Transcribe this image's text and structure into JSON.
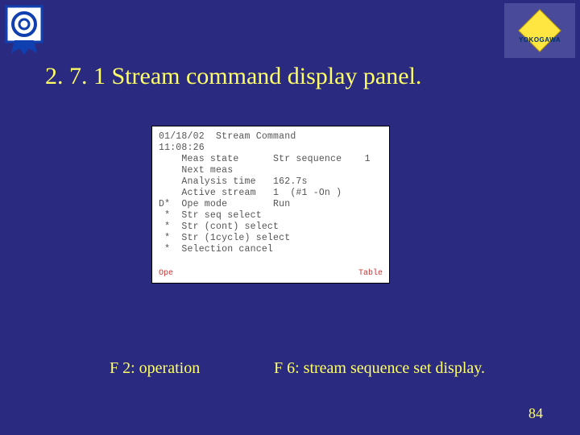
{
  "title": "2. 7. 1 Stream command display panel.",
  "panel": {
    "date": "01/18/02",
    "time": "11:08:26",
    "header": "Stream Command",
    "rows": [
      {
        "label": "Meas state",
        "mid": "Str sequence",
        "val": "1"
      },
      {
        "label": "Next meas",
        "mid": "",
        "val": ""
      },
      {
        "label": "Analysis time",
        "mid": "162.7s",
        "val": ""
      },
      {
        "label": "Active stream",
        "mid": "1  (#1 -On )",
        "val": ""
      },
      {
        "label": "Ope mode",
        "mid": "Run",
        "val": "",
        "mark": "D*"
      },
      {
        "label": "Str seq select",
        "mid": "",
        "val": "",
        "mark": " *"
      },
      {
        "label": "Str (cont) select",
        "mid": "",
        "val": "",
        "mark": " *"
      },
      {
        "label": "Str (1cycle) select",
        "mid": "",
        "val": "",
        "mark": " *"
      },
      {
        "label": "Selection cancel",
        "mid": "",
        "val": "",
        "mark": " *"
      }
    ],
    "footer_left": "Ope",
    "footer_right": "Table"
  },
  "caption_left": "F 2: operation",
  "caption_right": "F 6: stream sequence set display.",
  "page_number": "84",
  "brand_right": "YOKOGAWA"
}
